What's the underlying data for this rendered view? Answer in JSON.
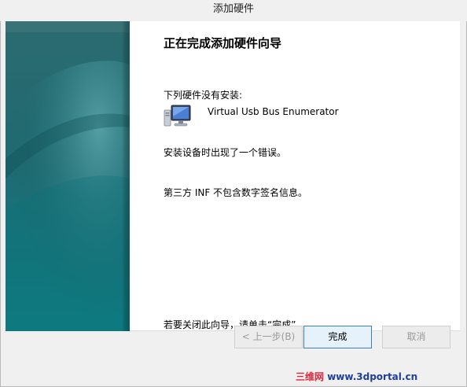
{
  "window": {
    "title": "添加硬件"
  },
  "wizard": {
    "heading": "正在完成添加硬件向导",
    "not_installed_label": "下列硬件没有安装:",
    "device": {
      "icon": "computer-monitor-icon",
      "name": "Virtual Usb Bus Enumerator"
    },
    "error_line": "安装设备时出现了一个错误。",
    "detail_line": "第三方 INF 不包含数字签名信息。",
    "close_hint": "若要关闭此向导，请单击“完成”。"
  },
  "buttons": {
    "back": "< 上一步(B)",
    "finish": "完成",
    "cancel": "取消"
  },
  "watermark": {
    "brand": "三维网",
    "url": "www.3dportal.cn"
  },
  "colors": {
    "sidebar_dark": "#0e5c63",
    "sidebar_light": "#3c9299",
    "default_button_border": "#3c7fb1",
    "watermark_red": "#e0263c",
    "watermark_blue": "#1d3f9a"
  }
}
